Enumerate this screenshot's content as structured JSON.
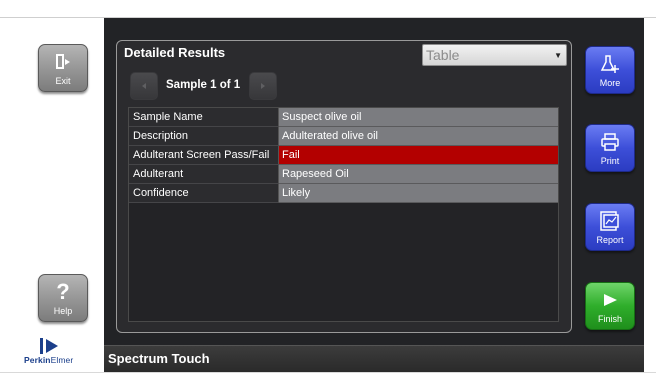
{
  "left_buttons": {
    "exit": {
      "label": "Exit",
      "icon": "exit-door-icon"
    },
    "help": {
      "label": "Help",
      "icon": "question-mark-icon"
    }
  },
  "right_buttons": {
    "more": {
      "label": "More",
      "icon": "flask-plus-icon"
    },
    "print": {
      "label": "Print",
      "icon": "printer-icon"
    },
    "report": {
      "label": "Report",
      "icon": "report-document-icon"
    },
    "finish": {
      "label": "Finish",
      "icon": "play-arrow-icon"
    }
  },
  "panel": {
    "title": "Detailed Results",
    "view_select": {
      "value": "Table"
    },
    "sample_nav": {
      "label": "Sample 1 of 1"
    }
  },
  "results": [
    {
      "key": "Sample Name",
      "value": "Suspect olive oil"
    },
    {
      "key": "Description",
      "value": "Adulterated olive oil"
    },
    {
      "key": "Adulterant Screen Pass/Fail",
      "value": "Fail"
    },
    {
      "key": "Adulterant",
      "value": "Rapeseed Oil"
    },
    {
      "key": "Confidence",
      "value": "Likely"
    }
  ],
  "status_bar": {
    "title": "Spectrum Touch"
  },
  "logo": {
    "brand_bold": "Perkin",
    "brand_light": "Elmer"
  },
  "colors": {
    "fail": "#b30000",
    "blue_button": "#3d4fd9",
    "green_button": "#2fae2b"
  }
}
